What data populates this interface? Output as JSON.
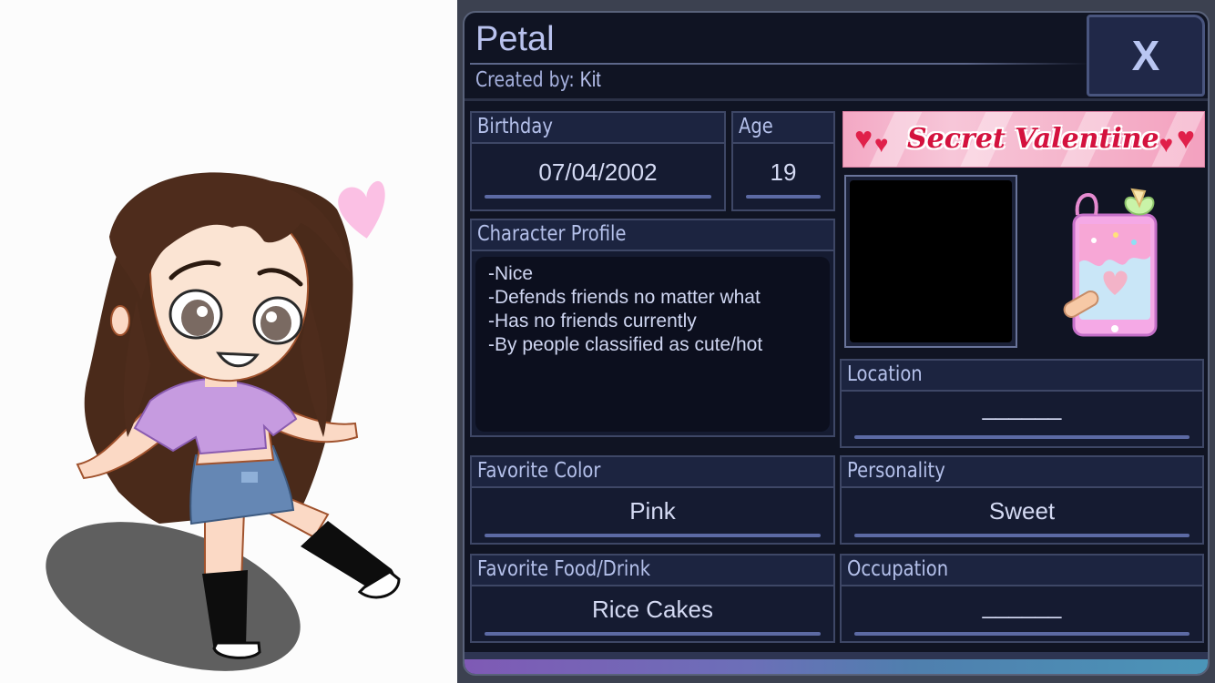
{
  "character": {
    "name": "Petal",
    "created_by_label": "Created by:",
    "created_by": "Kit"
  },
  "close_button": {
    "label": "X"
  },
  "fields": {
    "birthday": {
      "label": "Birthday",
      "value": "07/04/2002"
    },
    "age": {
      "label": "Age",
      "value": "19"
    },
    "profile": {
      "label": "Character Profile",
      "lines": [
        "-Nice",
        "-Defends friends no matter what",
        "-Has no friends currently",
        "-By people classified as cute/hot"
      ]
    },
    "location": {
      "label": "Location",
      "value": "______"
    },
    "favorite_color": {
      "label": "Favorite Color",
      "value": "Pink"
    },
    "personality": {
      "label": "Personality",
      "value": "Sweet"
    },
    "favorite_food": {
      "label": "Favorite Food/Drink",
      "value": "Rice Cakes"
    },
    "occupation": {
      "label": "Occupation",
      "value": "______"
    }
  },
  "banner": {
    "text": "Secret Valentine"
  },
  "colors": {
    "panel_bg": "#101423",
    "label_text": "#b4c0ea",
    "value_text": "#d4daf3",
    "accent": "#5c6aa4",
    "banner_pink": "#f5b7cd",
    "banner_text": "#d4123e"
  },
  "icons": {
    "close": "x-icon",
    "banner_hearts": "heart-icon",
    "phone": "phone-icon"
  }
}
